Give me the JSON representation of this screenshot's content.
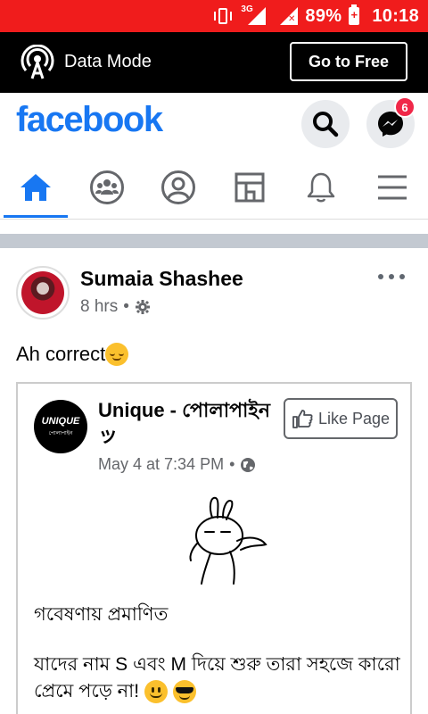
{
  "status_bar": {
    "network": "3G",
    "battery": "89%",
    "time": "10:18",
    "background": "#f01c1c"
  },
  "data_mode_bar": {
    "label": "Data Mode",
    "button": "Go to Free",
    "icon": "broadcast-icon"
  },
  "header": {
    "logo": "facebook",
    "brand_color": "#1877f2",
    "search_icon": "search-icon",
    "messenger_icon": "messenger-icon",
    "messenger_badge": "6"
  },
  "nav_tabs": [
    {
      "name": "home",
      "icon": "home-icon",
      "active": true
    },
    {
      "name": "groups",
      "icon": "groups-icon",
      "active": false
    },
    {
      "name": "profile",
      "icon": "profile-icon",
      "active": false
    },
    {
      "name": "pages",
      "icon": "pages-icon",
      "active": false
    },
    {
      "name": "notifications",
      "icon": "bell-icon",
      "active": false
    },
    {
      "name": "menu",
      "icon": "menu-icon",
      "active": false
    }
  ],
  "post": {
    "author": "Sumaia Shashee",
    "time": "8 hrs",
    "privacy_icon": "gear-icon",
    "text": "Ah correct",
    "text_emoji": "relieved-face",
    "shared": {
      "page_name": "Unique - পোলাপাইন ッ",
      "logo_text": "UNIQUE",
      "logo_subtext": "পোলাপাইন",
      "date": "May 4 at 7:34 PM",
      "privacy_icon": "globe-icon",
      "like_button": "Like Page",
      "heading": "গবেষণায় প্রমাণিত",
      "body": "যাদের নাম S এবং M দিয়ে শুরু তারা সহজে কারো প্রেমে পড়ে না!",
      "body_emojis": [
        "slightly-smiling-face",
        "sunglasses-face"
      ]
    }
  }
}
